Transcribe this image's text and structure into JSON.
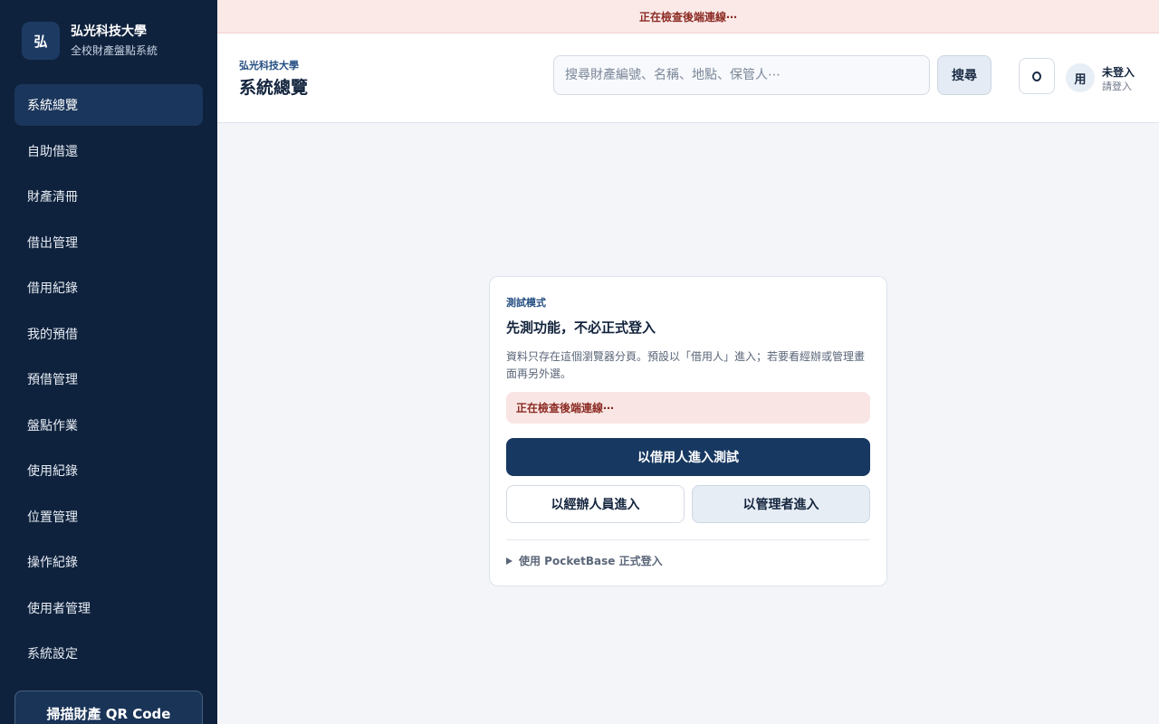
{
  "banner": {
    "text": "正在檢查後端連線⋯"
  },
  "brand": {
    "logo": "弘",
    "name": "弘光科技大學",
    "subtitle": "全校財產盤點系統"
  },
  "sidebar": {
    "items": [
      {
        "label": "系統總覽",
        "active": true
      },
      {
        "label": "自助借還"
      },
      {
        "label": "財產清冊"
      },
      {
        "label": "借出管理"
      },
      {
        "label": "借用紀錄"
      },
      {
        "label": "我的預借"
      },
      {
        "label": "預借管理"
      },
      {
        "label": "盤點作業"
      },
      {
        "label": "使用紀錄"
      },
      {
        "label": "位置管理"
      },
      {
        "label": "操作紀錄"
      },
      {
        "label": "使用者管理"
      },
      {
        "label": "系統設定"
      }
    ],
    "qr_button": "掃描財產 QR Code"
  },
  "header": {
    "breadcrumb": "弘光科技大學",
    "title": "系統總覽",
    "search_placeholder": "搜尋財產編號、名稱、地點、保管人⋯",
    "search_button": "搜尋",
    "user_avatar": "用",
    "user_name": "未登入",
    "user_sub": "請登入"
  },
  "card": {
    "tag": "測試模式",
    "title": "先測功能，不必正式登入",
    "description": "資料只存在這個瀏覽器分頁。預設以「借用人」進入；若要看經辦或管理畫面再另外選。",
    "status": "正在檢查後端連線⋯",
    "primary_button": "以借用人進入測試",
    "staff_button": "以經辦人員進入",
    "admin_button": "以管理者進入",
    "details_label": "使用 PocketBase 正式登入"
  },
  "colors": {
    "sidebar_bg": "#0f223d",
    "sidebar_active": "#1b365c",
    "primary": "#173861",
    "warning_bg": "#fbe9e8",
    "warning_text": "#8b2a22",
    "page_bg": "#f3f5f9"
  },
  "icons": {
    "theme_toggle": "circle-icon",
    "details_marker": "triangle-right-icon"
  }
}
